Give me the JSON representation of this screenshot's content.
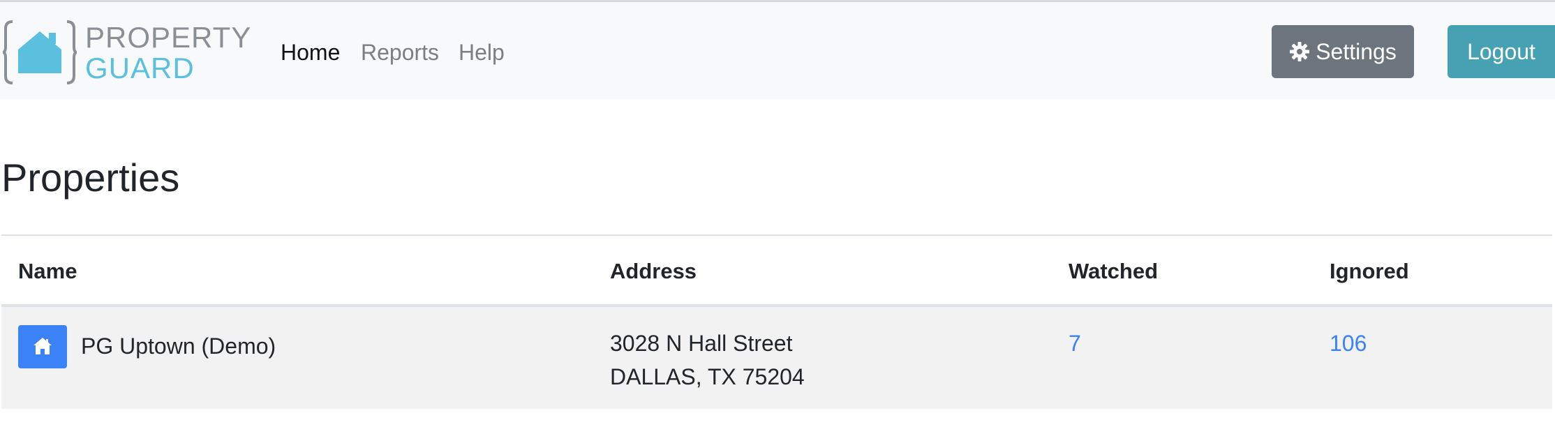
{
  "brand": {
    "line1": "PROPERTY",
    "line2": "GUARD",
    "icon": "house-logo-icon"
  },
  "nav": {
    "items": [
      {
        "label": "Home",
        "active": true
      },
      {
        "label": "Reports",
        "active": false
      },
      {
        "label": "Help",
        "active": false
      }
    ]
  },
  "actions": {
    "settings_label": "Settings",
    "settings_icon": "gear-icon",
    "logout_label": "Logout"
  },
  "page": {
    "title": "Properties"
  },
  "table": {
    "columns": [
      "Name",
      "Address",
      "Watched",
      "Ignored"
    ],
    "rows": [
      {
        "icon": "home-icon",
        "name": "PG Uptown (Demo)",
        "address_line1": "3028 N Hall Street",
        "address_line2": "DALLAS, TX 75204",
        "watched": "7",
        "ignored": "106"
      }
    ]
  },
  "colors": {
    "brand_gray": "#8a8f96",
    "brand_blue": "#5bc0de",
    "settings_button": "#6c757d",
    "logout_button": "#46a2b3",
    "link": "#3b82f6"
  }
}
